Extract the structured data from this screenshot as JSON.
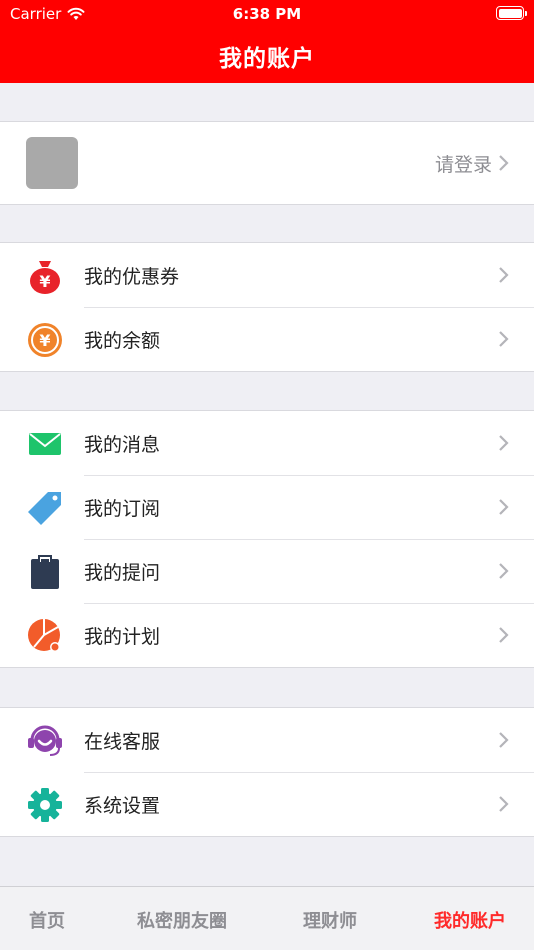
{
  "status_bar": {
    "carrier": "Carrier",
    "time": "6:38 PM"
  },
  "nav": {
    "title": "我的账户"
  },
  "login": {
    "text": "请登录"
  },
  "group1": [
    {
      "label": "我的优惠券",
      "icon": "money-bag-icon",
      "color": "#e8232a"
    },
    {
      "label": "我的余额",
      "icon": "yen-coin-icon",
      "color": "#f0832a"
    }
  ],
  "group2": [
    {
      "label": "我的消息",
      "icon": "envelope-icon",
      "color": "#1ec46b"
    },
    {
      "label": "我的订阅",
      "icon": "tag-icon",
      "color": "#4aa3e0"
    },
    {
      "label": "我的提问",
      "icon": "clipboard-icon",
      "color": "#2e3b52"
    },
    {
      "label": "我的计划",
      "icon": "pie-chart-icon",
      "color": "#f25c2a"
    }
  ],
  "group3": [
    {
      "label": "在线客服",
      "icon": "headset-icon",
      "color": "#8e44ad"
    },
    {
      "label": "系统设置",
      "icon": "gear-icon",
      "color": "#16b39a"
    }
  ],
  "tabs": [
    {
      "label": "首页",
      "active": false
    },
    {
      "label": "私密朋友圈",
      "active": false
    },
    {
      "label": "理财师",
      "active": false
    },
    {
      "label": "我的账户",
      "active": true
    }
  ],
  "colors": {
    "brand": "#ff0000",
    "active_tab": "#ff2a2a"
  }
}
